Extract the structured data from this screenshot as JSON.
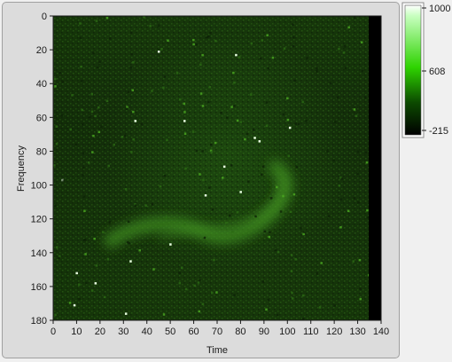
{
  "chart_data": {
    "type": "heatmap",
    "title": "",
    "xlabel": "Time",
    "ylabel": "Frequency",
    "xlim": [
      0,
      140
    ],
    "ylim": [
      0,
      180
    ],
    "y_inverted": true,
    "x_ticks": [
      "0",
      "10",
      "20",
      "30",
      "40",
      "50",
      "60",
      "70",
      "80",
      "90",
      "100",
      "110",
      "120",
      "130",
      "140"
    ],
    "y_ticks": [
      "0",
      "20",
      "40",
      "60",
      "80",
      "100",
      "120",
      "140",
      "160",
      "180"
    ],
    "data_extent_x": [
      0,
      135
    ],
    "colorbar": {
      "min": -215,
      "mid": 608,
      "max": 1000,
      "labels": [
        "1000",
        "608",
        "-215"
      ],
      "colors": [
        "#ffffff",
        "#00e000",
        "#000000"
      ]
    },
    "features": [
      {
        "label": "arc",
        "x": [
          48,
          100
        ],
        "y": [
          90,
          145
        ]
      }
    ],
    "hot_pixels": [
      [
        45,
        21
      ],
      [
        78,
        23
      ],
      [
        35,
        62
      ],
      [
        56,
        62
      ],
      [
        86,
        72
      ],
      [
        88,
        74
      ],
      [
        101,
        66
      ],
      [
        73,
        89
      ],
      [
        4,
        97
      ],
      [
        65,
        106
      ],
      [
        80,
        104
      ],
      [
        50,
        135
      ],
      [
        33,
        145
      ],
      [
        10,
        152
      ],
      [
        18,
        158
      ],
      [
        9,
        171
      ],
      [
        31,
        176
      ]
    ],
    "grid": false,
    "background_colors": {
      "dark": "#0a1a05",
      "mid": "#1f4a10",
      "bright": "#3a7a1a"
    }
  }
}
